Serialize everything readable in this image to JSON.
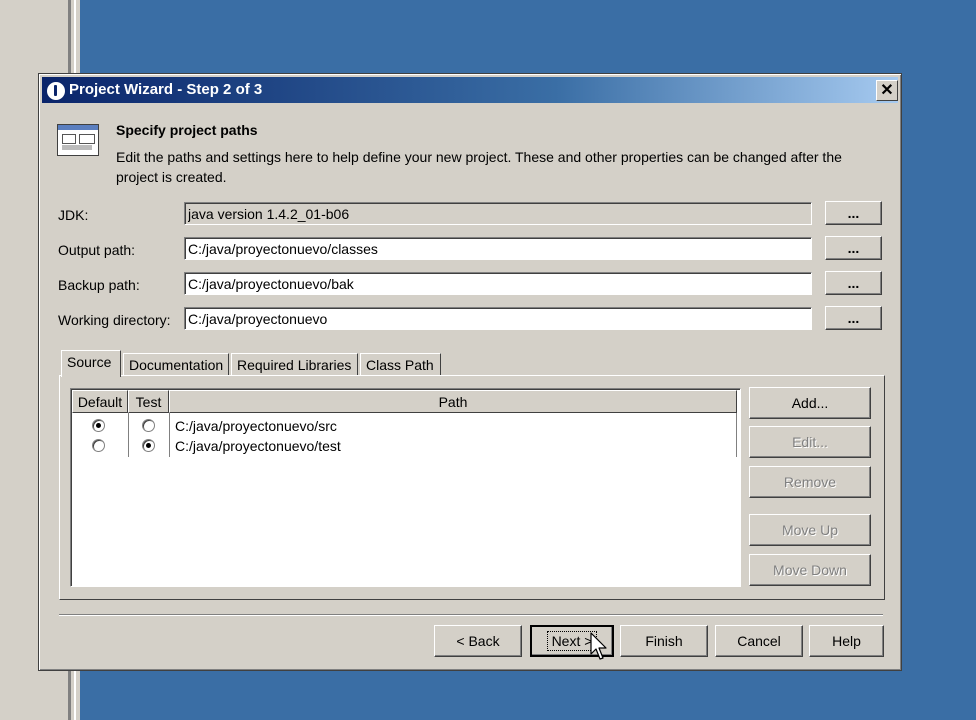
{
  "dialog": {
    "title": "Project Wizard - Step 2 of 3",
    "close_glyph": "✕"
  },
  "header": {
    "heading": "Specify project paths",
    "description": "Edit the paths and settings here to help define your new project. These and other properties can be changed after the project is created."
  },
  "fields": {
    "jdk": {
      "label": "JDK:",
      "value": "java version 1.4.2_01-b06"
    },
    "output": {
      "label": "Output path:",
      "value": "C:/java/proyectonuevo/classes"
    },
    "backup": {
      "label": "Backup path:",
      "value": "C:/java/proyectonuevo/bak"
    },
    "working": {
      "label": "Working directory:",
      "value": "C:/java/proyectonuevo"
    },
    "browse_label": "..."
  },
  "tabs": [
    {
      "label": "Source",
      "active": true
    },
    {
      "label": "Documentation"
    },
    {
      "label": "Required Libraries"
    },
    {
      "label": "Class Path"
    }
  ],
  "table": {
    "headers": [
      "Default",
      "Test",
      "Path"
    ],
    "rows": [
      {
        "default": true,
        "test": false,
        "path": "C:/java/proyectonuevo/src"
      },
      {
        "default": false,
        "test": true,
        "path": "C:/java/proyectonuevo/test"
      }
    ]
  },
  "side_buttons": {
    "add": "Add...",
    "edit": "Edit...",
    "remove": "Remove",
    "move_up": "Move Up",
    "move_down": "Move Down"
  },
  "footer_buttons": {
    "back": "< Back",
    "next": "Next >",
    "finish": "Finish",
    "cancel": "Cancel",
    "help": "Help"
  }
}
